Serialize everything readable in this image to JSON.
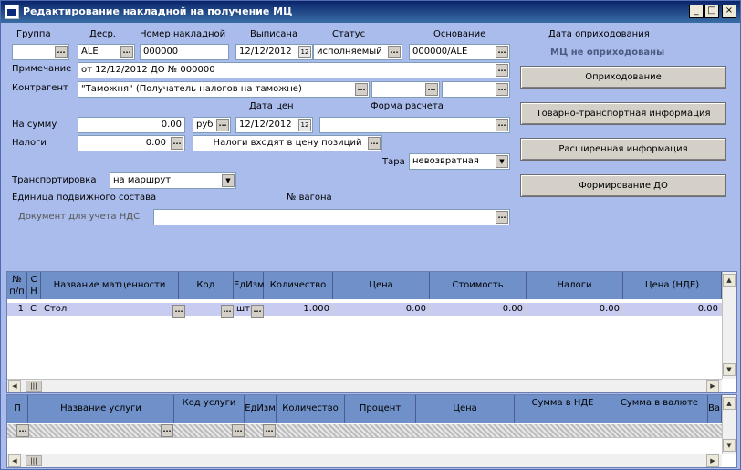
{
  "window": {
    "title": "Редактирование накладной на получение МЦ",
    "minimize": "_",
    "maximize": "□",
    "close": "×"
  },
  "headers": {
    "group": "Группа",
    "descr": "Деср.",
    "number": "Номер накладной",
    "issued": "Выписана",
    "status": "Статус",
    "basis": "Основание",
    "receipt_date": "Дата оприходования"
  },
  "fields": {
    "group": "",
    "descr": "ALE",
    "number": "000000",
    "issued_date": "12/12/2012",
    "status": "исполняемый",
    "basis": "000000/ALE",
    "receipt_status": "МЦ не оприходованы",
    "note_label": "Примечание",
    "note": "от 12/12/2012 ДО № 000000",
    "counterparty_label": "Контрагент",
    "counterparty": "\"Таможня\" (Получатель налогов на таможне)",
    "price_date_label": "Дата цен",
    "payment_form_label": "Форма расчета",
    "sum_label": "На сумму",
    "sum": "0.00",
    "currency": "руб",
    "price_date": "12/12/2012",
    "taxes_label": "Налоги",
    "taxes": "0.00",
    "tax_mode": "Налоги входят в цену позиций",
    "tara_label": "Тара",
    "tara": "невозвратная",
    "transport_label": "Транспортировка",
    "transport": "на маршрут",
    "rolling_unit_label": "Единица подвижного состава",
    "wagon_label": "№ вагона",
    "vat_doc_label": "Документ для учета НДС"
  },
  "buttons": {
    "receive": "Оприходование",
    "transport_info": "Товарно-транспортная информация",
    "extended_info": "Расширенная информация",
    "form_do": "Формирование ДО"
  },
  "goods_table": {
    "columns": [
      "№ п/п",
      "С Н",
      "Название матценности",
      "Код",
      "ЕдИзм",
      "Количество",
      "Цена",
      "Стоимость",
      "Налоги",
      "Цена (НДЕ)"
    ],
    "rows": [
      {
        "n": "1",
        "c": "С",
        "name": "Стол",
        "code": "",
        "unit": "шт",
        "qty": "1.000",
        "price": "0.00",
        "cost": "0.00",
        "taxes": "0.00",
        "price_nde": "0.00"
      }
    ]
  },
  "services_table": {
    "columns": [
      "П",
      "Название услуги",
      "Код услуги",
      "ЕдИзм",
      "Количество",
      "Процент",
      "Цена",
      "Сумма в НДЕ",
      "Сумма в валюте",
      "Ва"
    ]
  },
  "glyphs": {
    "dots": "...",
    "cal": "12",
    "dropdown": "▼",
    "left": "◀",
    "right": "▶",
    "up": "▲",
    "down": "▼",
    "grip": "|||"
  }
}
